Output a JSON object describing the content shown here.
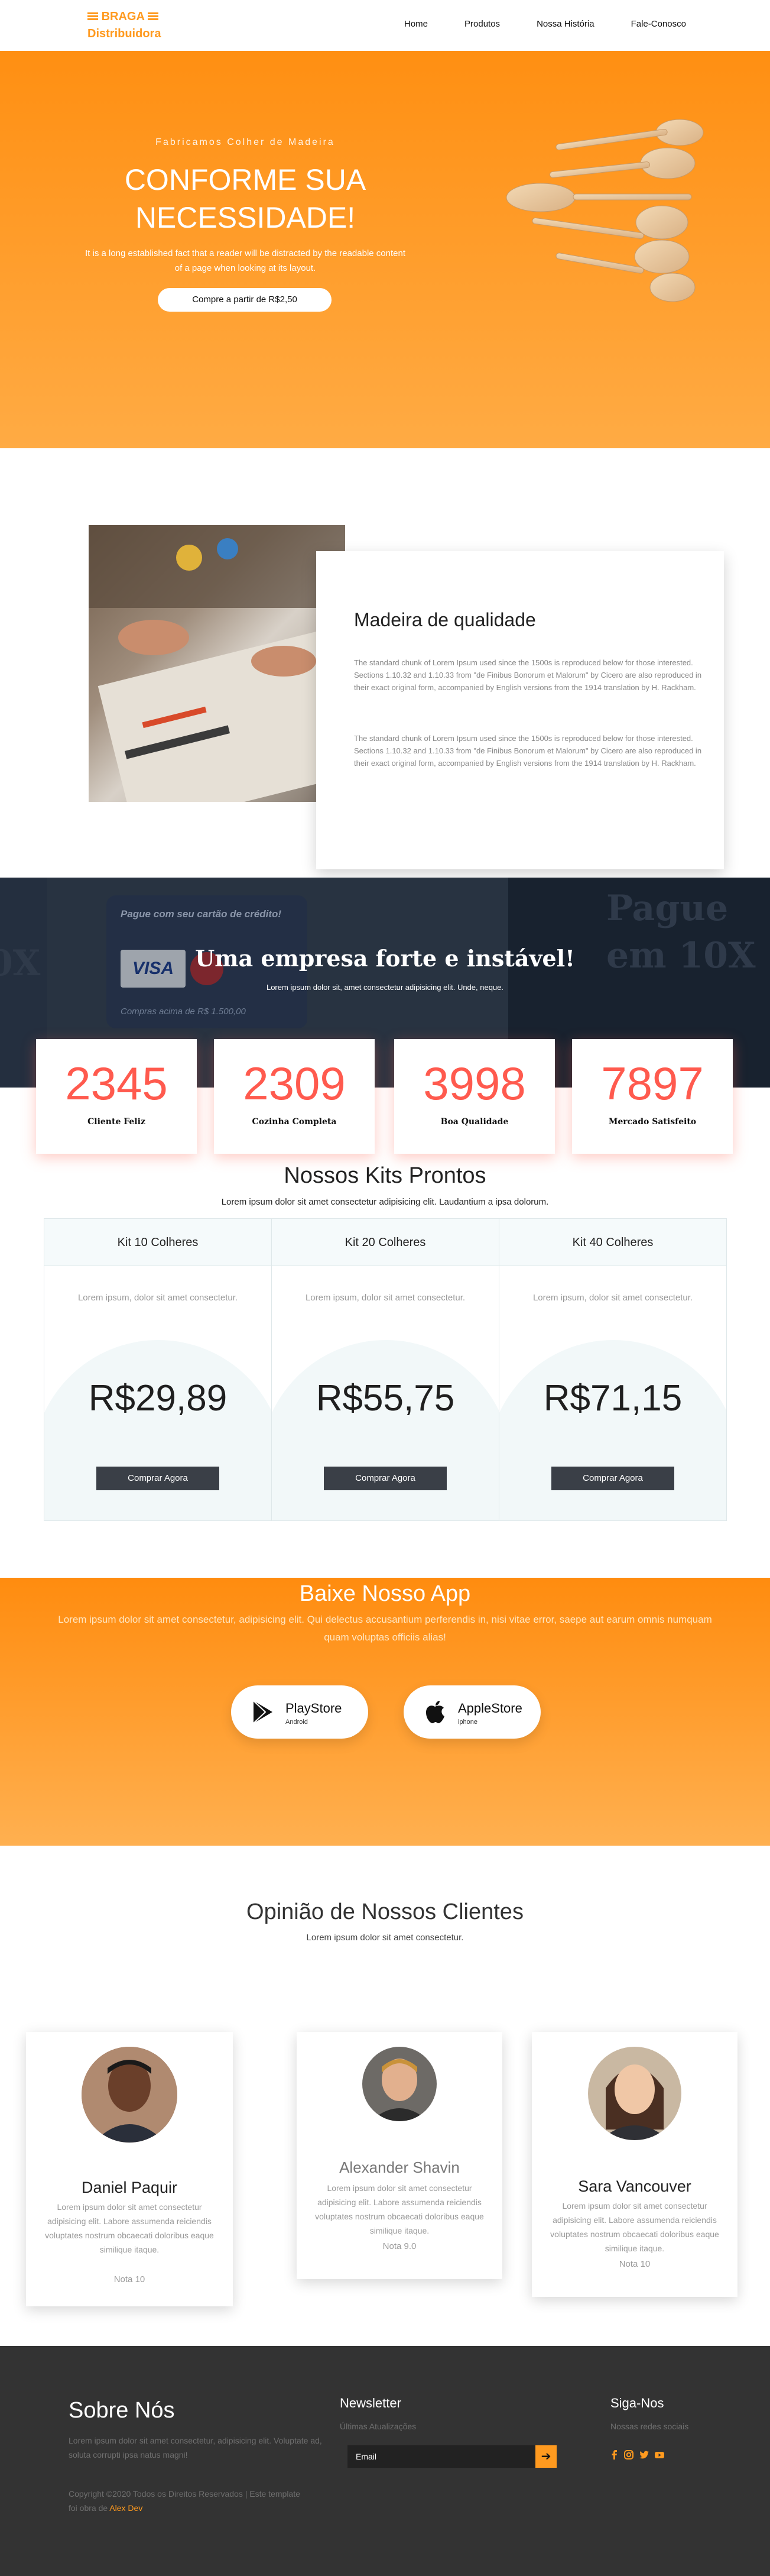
{
  "brand": {
    "line1": "BRAGA",
    "line2": "Distribuidora",
    "accent": "#ff9a1f"
  },
  "nav": {
    "items": [
      "Home",
      "Produtos",
      "Nossa História",
      "Fale-Conosco"
    ]
  },
  "hero": {
    "eyebrow": "Fabricamos Colher de Madeira",
    "title_line1": "CONFORME SUA",
    "title_line2": "NECESSIDADE!",
    "text": "It is a long established fact that a reader will be distracted by the readable content of a page when looking at its layout.",
    "button": "Compre a partir de R$2,50"
  },
  "quality": {
    "title": "Madeira de qualidade",
    "p1": "The standard chunk of Lorem Ipsum used since the 1500s is reproduced below for those interested. Sections 1.10.32 and 1.10.33 from \"de Finibus Bonorum et Malorum\" by Cicero are also reproduced in their exact original form, accompanied by English versions from the 1914 translation by H. Rackham.",
    "p2": "The standard chunk of Lorem Ipsum used since the 1500s is reproduced below for those interested. Sections 1.10.32 and 1.10.33 from \"de Finibus Bonorum et Malorum\" by Cicero are also reproduced in their exact original form, accompanied by English versions from the 1914 translation by H. Rackham."
  },
  "band": {
    "title": "Uma empresa forte e instável!",
    "sub": "Lorem ipsum dolor sit, amet consectetur adipisicing elit. Unde, neque.",
    "card_line1": "Pague com seu cartão de crédito!",
    "card_line2": "Compras acima de R$ 1.500,00",
    "right_text1": "Pague",
    "right_text2": "em 10X",
    "left_text": "0X",
    "visa": "VISA"
  },
  "stats": [
    {
      "value": "2345",
      "label": "Cliente Feliz"
    },
    {
      "value": "2309",
      "label": "Cozinha Completa"
    },
    {
      "value": "3998",
      "label": "Boa Qualidade"
    },
    {
      "value": "7897",
      "label": "Mercado Satisfeito"
    }
  ],
  "kits": {
    "title": "Nossos Kits Prontos",
    "sub": "Lorem ipsum dolor sit amet consectetur adipisicing elit. Laudantium a ipsa dolorum.",
    "items": [
      {
        "name": "Kit 10 Colheres",
        "desc": "Lorem ipsum, dolor sit amet consectetur.",
        "price": "R$29,89",
        "button": "Comprar Agora"
      },
      {
        "name": "Kit 20 Colheres",
        "desc": "Lorem ipsum, dolor sit amet consectetur.",
        "price": "R$55,75",
        "button": "Comprar Agora"
      },
      {
        "name": "Kit 40 Colheres",
        "desc": "Lorem ipsum, dolor sit amet consectetur.",
        "price": "R$71,15",
        "button": "Comprar Agora"
      }
    ]
  },
  "app": {
    "title": "Baixe Nosso App",
    "text": "Lorem ipsum dolor sit amet consectetur, adipisicing elit. Qui delectus accusantium perferendis in, nisi vitae error, saepe aut earum omnis numquam quam voluptas officiis alias!",
    "stores": [
      {
        "name": "PlayStore",
        "sub": "Android"
      },
      {
        "name": "AppleStore",
        "sub": "iphone"
      }
    ]
  },
  "testimonials": {
    "title": "Opinião de Nossos Clientes",
    "sub": "Lorem ipsum dolor sit amet consectetur.",
    "items": [
      {
        "name": "Daniel Paquir",
        "text": "Lorem ipsum dolor sit amet consectetur adipisicing elit. Labore assumenda reiciendis voluptates nostrum obcaecati doloribus eaque similique itaque.",
        "note": "Nota 10"
      },
      {
        "name": "Alexander Shavin",
        "text": "Lorem ipsum dolor sit amet consectetur adipisicing elit. Labore assumenda reiciendis voluptates nostrum obcaecati doloribus eaque similique itaque.",
        "note": "Nota 9.0"
      },
      {
        "name": "Sara Vancouver",
        "text": "Lorem ipsum dolor sit amet consectetur adipisicing elit. Labore assumenda reiciendis voluptates nostrum obcaecati doloribus eaque similique itaque.",
        "note": "Nota 10"
      }
    ]
  },
  "footer": {
    "about_title": "Sobre Nós",
    "about_text": "Lorem ipsum dolor sit amet consectetur, adipisicing elit. Voluptate ad, soluta corrupti ipsa natus magni!",
    "copyright": "Copyright ©2020 Todos os Direitos Reservados | Este template foi obra de",
    "author": "Alex Dev",
    "newsletter_title": "Newsletter",
    "newsletter_sub": "Últimas Atualizações",
    "email_placeholder": "Email",
    "email_button": "➔",
    "follow_title": "Siga-Nos",
    "follow_sub": "Nossas redes sociais",
    "socials": [
      "facebook-icon",
      "instagram-icon",
      "twitter-icon",
      "youtube-icon"
    ]
  }
}
